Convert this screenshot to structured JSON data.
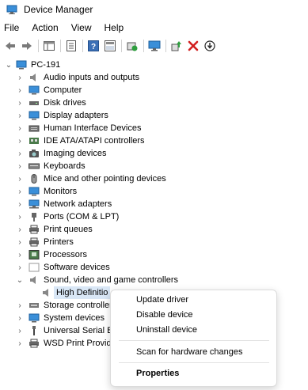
{
  "window": {
    "title": "Device Manager",
    "icon": "device-manager-icon"
  },
  "menu": [
    "File",
    "Action",
    "View",
    "Help"
  ],
  "toolbar": {
    "buttons": [
      "back-icon",
      "forward-icon",
      "show-hide-console-tree-icon",
      "properties-icon",
      "help-icon",
      "show-hidden-icon",
      "scan-hardware-icon",
      "monitor-icon",
      "update-driver-icon",
      "uninstall-device-icon",
      "disable-device-icon"
    ]
  },
  "tree": {
    "root": "PC-191",
    "categories": [
      "Audio inputs and outputs",
      "Computer",
      "Disk drives",
      "Display adapters",
      "Human Interface Devices",
      "IDE ATA/ATAPI controllers",
      "Imaging devices",
      "Keyboards",
      "Mice and other pointing devices",
      "Monitors",
      "Network adapters",
      "Ports (COM & LPT)",
      "Print queues",
      "Printers",
      "Processors",
      "Software devices",
      "Sound, video and game controllers",
      "Storage controller",
      "System devices",
      "Universal Serial Bu",
      "WSD Print Provide"
    ],
    "expanded_child": "High Definitio"
  },
  "context_menu": {
    "items": [
      "Update driver",
      "Disable device",
      "Uninstall device",
      "Scan for hardware changes",
      "Properties"
    ]
  },
  "colors": {
    "selection": "#d9e7f6",
    "accent_green": "#2e9e3e",
    "accent_red": "#d21f1f"
  }
}
